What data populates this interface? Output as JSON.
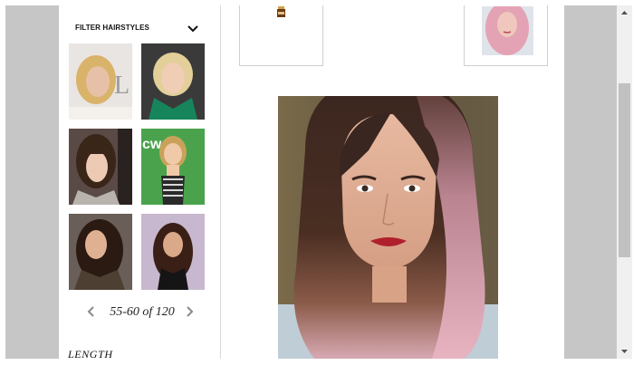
{
  "sidebar": {
    "filter_title": "FILTER HAIRSTYLES",
    "chevron_icon": "chevron-down-icon",
    "thumbnails": [
      {
        "name": "hairstyle-thumb-1",
        "bg": "#e9e5e2",
        "hair": "#d9b36a",
        "skin": "#e7c1a7",
        "top": "#f4f0ec"
      },
      {
        "name": "hairstyle-thumb-2",
        "bg": "#3a3a3a",
        "hair": "#e2cf9a",
        "skin": "#f0cdb5",
        "top": "#17855c"
      },
      {
        "name": "hairstyle-thumb-3",
        "bg": "#5a4a46",
        "hair": "#3a2519",
        "skin": "#eccab4",
        "top": "#b9b3ad"
      },
      {
        "name": "hairstyle-thumb-4",
        "bg": "#4aa34c",
        "hair": "#c9a25a",
        "skin": "#f0c9a8",
        "top": "#2a2a2a"
      },
      {
        "name": "hairstyle-thumb-5",
        "bg": "#6a5e58",
        "hair": "#2b1a12",
        "skin": "#e0b093",
        "top": "#4d3f32"
      },
      {
        "name": "hairstyle-thumb-6",
        "bg": "#c7b8cf",
        "hair": "#3a1f16",
        "skin": "#d9a98a",
        "top": "#151515"
      }
    ],
    "pager": {
      "prev_icon": "chevron-left-icon",
      "text": "55-60 of 120",
      "next_icon": "chevron-right-icon"
    },
    "length_label": "LENGTH"
  },
  "main": {
    "card_left_icon": "product-bottle-icon",
    "card_right_image": "pink-hair-thumbnail",
    "portrait": "hairstyle-portrait-image"
  },
  "scrollbar": {
    "up_icon": "scroll-up-arrow-icon",
    "down_icon": "scroll-down-arrow-icon"
  }
}
